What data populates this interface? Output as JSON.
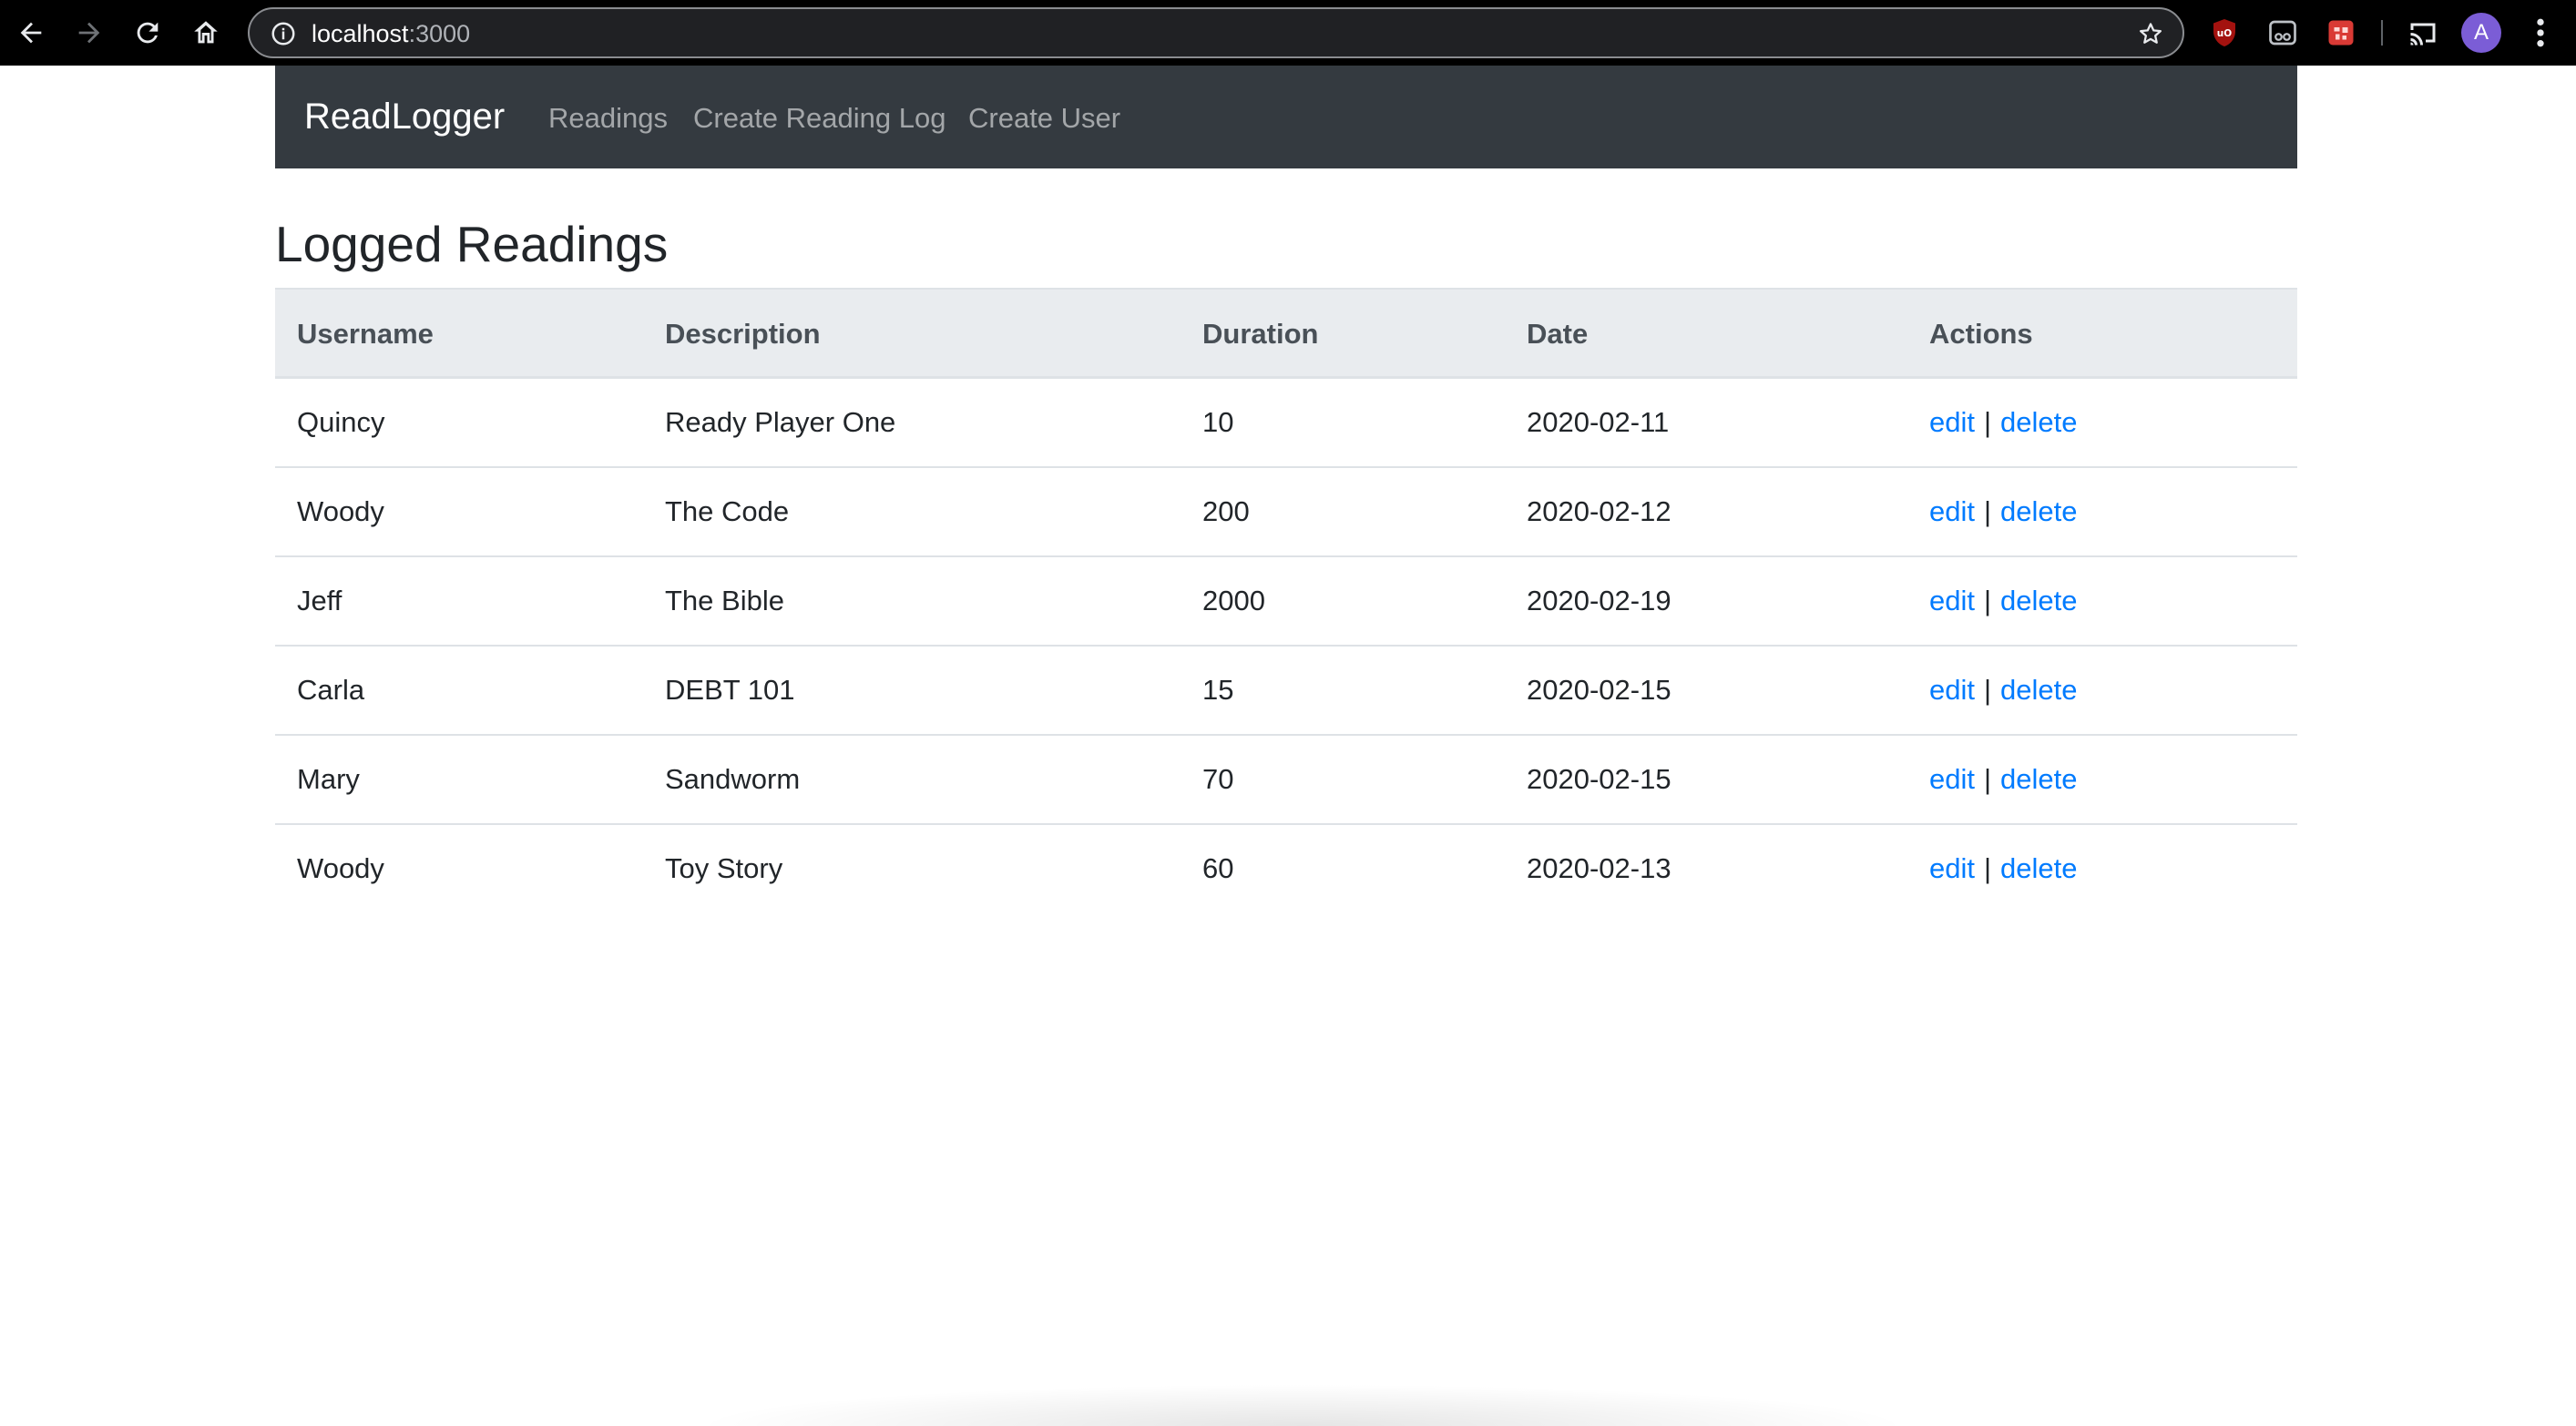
{
  "browser": {
    "url_host": "localhost",
    "url_port": ":3000",
    "avatar_letter": "A",
    "icons": [
      "back-icon",
      "forward-icon",
      "reload-icon",
      "home-icon",
      "info-icon",
      "star-icon",
      "ublock-icon",
      "extension-icon",
      "extension-red-icon",
      "cast-icon",
      "kebab-menu-icon"
    ]
  },
  "navbar": {
    "brand": "ReadLogger",
    "links": [
      {
        "label": "Readings"
      },
      {
        "label": "Create Reading Log"
      },
      {
        "label": "Create User"
      }
    ]
  },
  "page": {
    "title": "Logged Readings"
  },
  "table": {
    "headers": [
      "Username",
      "Description",
      "Duration",
      "Date",
      "Actions"
    ],
    "rows": [
      {
        "username": "Quincy",
        "description": "Ready Player One",
        "duration": "10",
        "date": "2020-02-11",
        "edit": "edit",
        "sep": "|",
        "delete": "delete"
      },
      {
        "username": "Woody",
        "description": "The Code",
        "duration": "200",
        "date": "2020-02-12",
        "edit": "edit",
        "sep": "|",
        "delete": "delete"
      },
      {
        "username": "Jeff",
        "description": "The Bible",
        "duration": "2000",
        "date": "2020-02-19",
        "edit": "edit",
        "sep": "|",
        "delete": "delete"
      },
      {
        "username": "Carla",
        "description": "DEBT 101",
        "duration": "15",
        "date": "2020-02-15",
        "edit": "edit",
        "sep": "|",
        "delete": "delete"
      },
      {
        "username": "Mary",
        "description": "Sandworm",
        "duration": "70",
        "date": "2020-02-15",
        "edit": "edit",
        "sep": "|",
        "delete": "delete"
      },
      {
        "username": "Woody",
        "description": "Toy Story",
        "duration": "60",
        "date": "2020-02-13",
        "edit": "edit",
        "sep": "|",
        "delete": "delete"
      }
    ]
  },
  "colors": {
    "navbar_bg": "#343a40",
    "link_blue": "#007bff",
    "thead_bg": "#e9ecef",
    "avatar_bg": "#7b5dd6"
  }
}
